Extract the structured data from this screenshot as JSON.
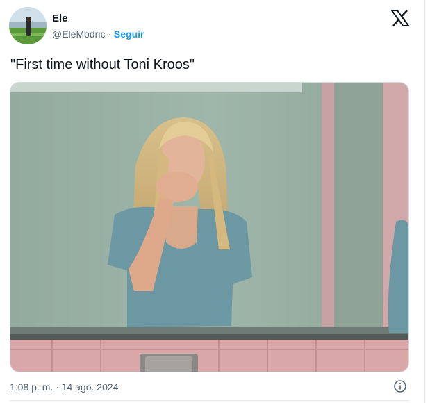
{
  "author": {
    "name": "Ele",
    "handle": "@EleModric",
    "separator": "·",
    "follow_label": "Seguir"
  },
  "tweet": {
    "text": "\"First time without Toni Kroos\""
  },
  "media": {
    "description_icon": "photo"
  },
  "footer": {
    "timestamp": "1:08 p. m. · 14 ago. 2024",
    "info_icon": "info-icon"
  },
  "colors": {
    "link": "#1d9bf0",
    "muted": "#536471",
    "text": "#0f1419"
  }
}
